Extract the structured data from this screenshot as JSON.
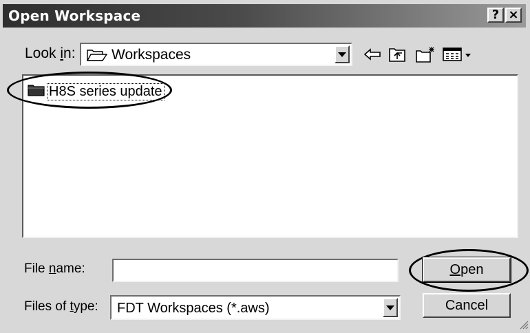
{
  "window": {
    "title": "Open Workspace",
    "help_label": "?",
    "close_label": "×"
  },
  "lookin": {
    "label_pre": "Look ",
    "label_key": "i",
    "label_post": "n:",
    "value": "Workspaces",
    "icon": "folder-open-icon"
  },
  "toolbar": {
    "icons": [
      "back-arrow-icon",
      "up-one-level-icon",
      "create-new-folder-icon",
      "view-menu-icon"
    ]
  },
  "filelist": {
    "items": [
      {
        "label": "H8S series update",
        "icon": "folder-icon"
      }
    ]
  },
  "filename": {
    "label_pre": "File ",
    "label_key": "n",
    "label_post": "ame:",
    "value": "",
    "placeholder": ""
  },
  "filetype": {
    "label_pre": "Files of ",
    "label_key": "t",
    "label_post": "ype:",
    "value": "FDT Workspaces (*.aws)"
  },
  "buttons": {
    "open_key": "O",
    "open_rest": "pen",
    "cancel": "Cancel"
  },
  "colors": {
    "titlebar_start": "#2e2e2e",
    "titlebar_end": "#9a9a9a",
    "face": "#d8d8d8"
  }
}
